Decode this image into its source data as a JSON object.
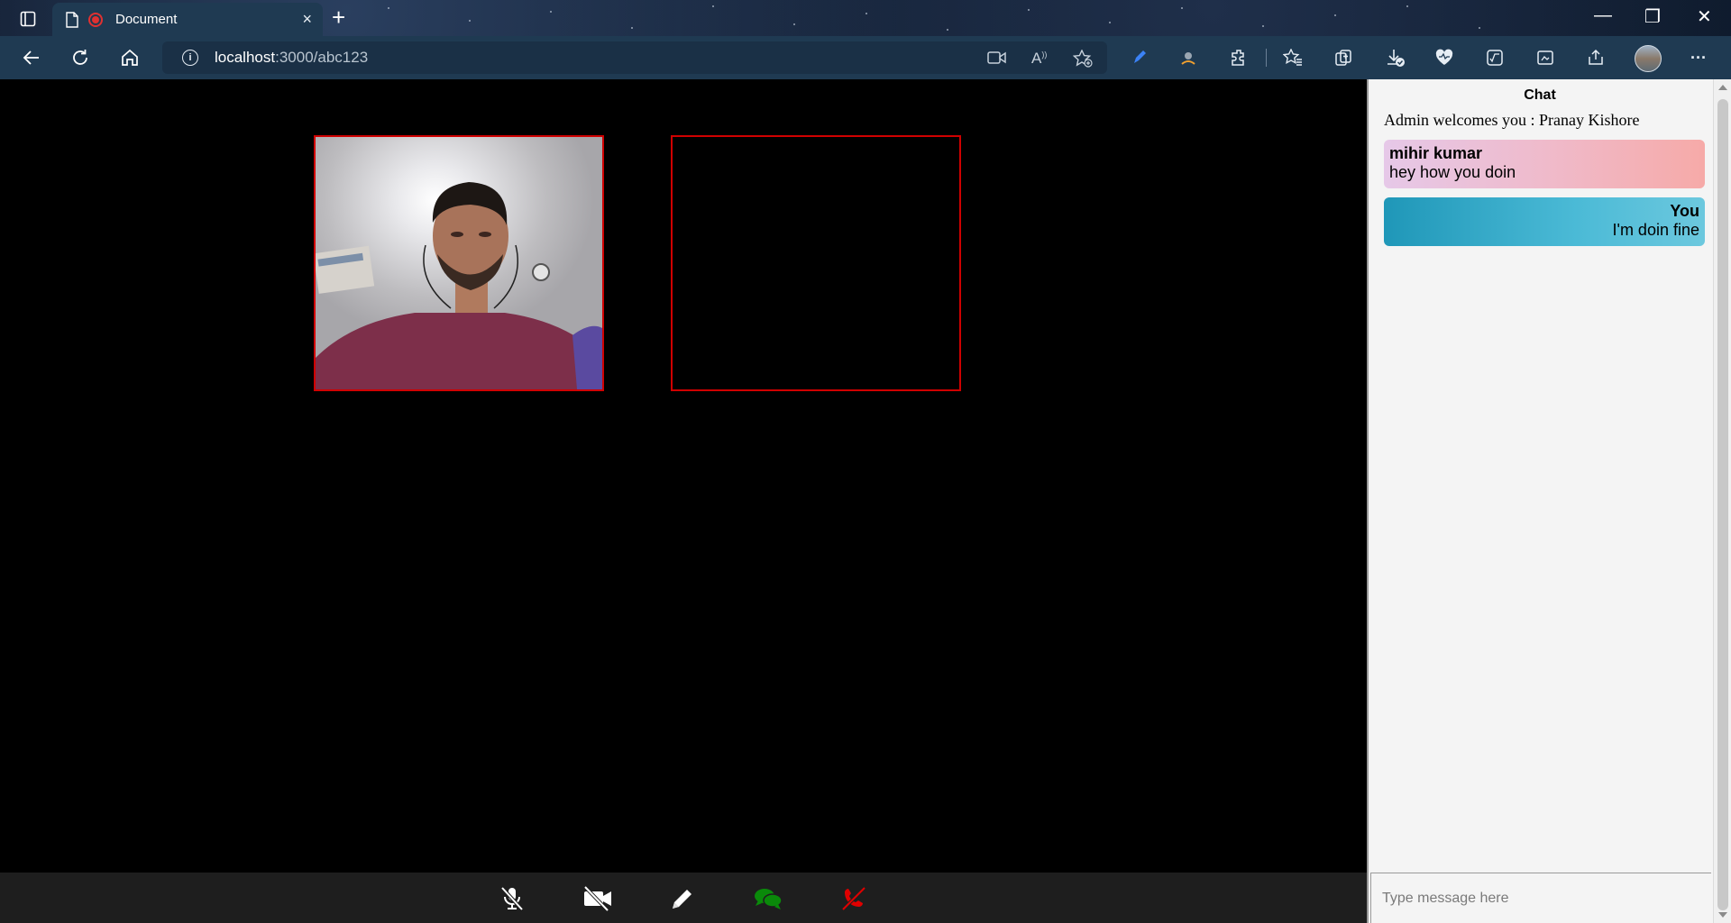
{
  "browser": {
    "tab_title": "Document",
    "tab_close": "×",
    "new_tab": "+",
    "url_host": "localhost",
    "url_path": ":3000/abc123",
    "window_controls": {
      "minimize": "—",
      "restore": "❐",
      "close": "✕"
    },
    "toolbar_more": "···"
  },
  "chat": {
    "header": "Chat",
    "welcome": "Admin welcomes you : Pranay Kishore",
    "messages": [
      {
        "sender": "mihir kumar",
        "text": "hey how you doin",
        "direction": "incoming"
      },
      {
        "sender": "You",
        "text": "I'm doin fine",
        "direction": "outgoing"
      }
    ],
    "input_placeholder": "Type message here"
  },
  "controls": [
    {
      "name": "mute-mic",
      "icon": "mic-off-icon",
      "color": "#ffffff"
    },
    {
      "name": "toggle-video",
      "icon": "video-off-icon",
      "color": "#ffffff"
    },
    {
      "name": "whiteboard",
      "icon": "pencil-icon",
      "color": "#ffffff"
    },
    {
      "name": "chat",
      "icon": "chat-icon",
      "color": "#0a8a0a"
    },
    {
      "name": "end-call",
      "icon": "phone-hangup-icon",
      "color": "#e00000"
    }
  ],
  "colors": {
    "video_border": "#d00000",
    "incoming_bubble": "#f0b9c8",
    "outgoing_bubble": "#4bbad6"
  }
}
